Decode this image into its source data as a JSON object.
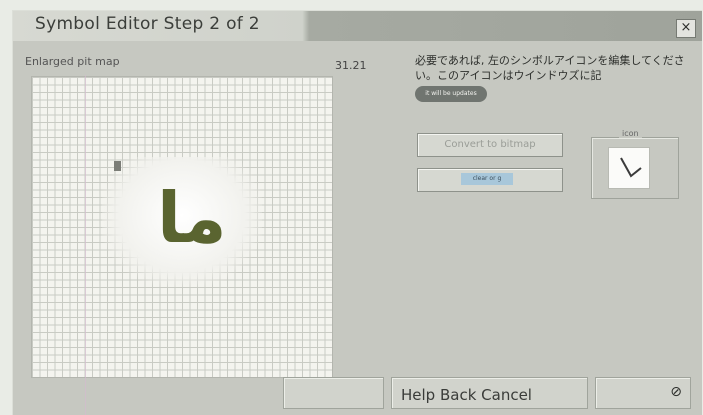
{
  "window": {
    "title": "Symbol Editor Step 2 of 2",
    "close_glyph": "×"
  },
  "left_panel": {
    "map_label": "Enlarged pit map",
    "coordinates": "31.21",
    "glyph": "ما"
  },
  "right_panel": {
    "instruction": "必要であれば, 左のシンボルアイコンを編集してください。このアイコンはウインドウズに記",
    "tooltip": "it will be updates",
    "convert_button_label": "Convert to bitmap",
    "clear_button_label": "clear or g",
    "icon_label": "icon"
  },
  "bottom": {
    "buttons_text": "Help Back Cancel",
    "help_icon": "⊘"
  }
}
